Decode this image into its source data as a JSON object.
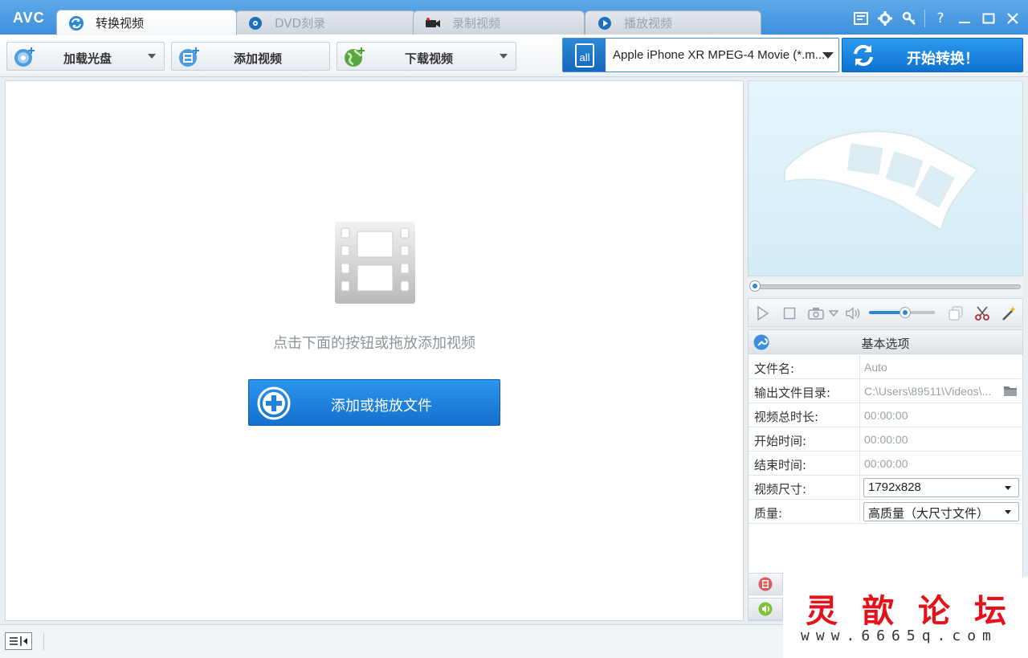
{
  "app": {
    "logo": "AVC"
  },
  "tabs": [
    {
      "label": "转换视频",
      "active": true,
      "icon": "refresh-icon"
    },
    {
      "label": "DVD刻录",
      "active": false,
      "icon": "disc-icon"
    },
    {
      "label": "录制视频",
      "active": false,
      "icon": "camera-icon"
    },
    {
      "label": "播放视频",
      "active": false,
      "icon": "play-icon"
    }
  ],
  "window_controls": [
    "list-icon",
    "gear-icon",
    "key-icon",
    "help-icon",
    "minimize-icon",
    "maximize-icon",
    "close-icon"
  ],
  "toolbar": {
    "load_disc": "加载光盘",
    "add_video": "添加视频",
    "download_video": "下载视频",
    "profile_selected": "Apple iPhone XR MPEG-4 Movie (*.m...",
    "convert": "开始转换！"
  },
  "main": {
    "hint": "点击下面的按钮或拖放添加视频",
    "add_button": "添加或拖放文件"
  },
  "player": {
    "seek_position": 0,
    "volume": 0.55
  },
  "options": {
    "title": "基本选项",
    "rows": [
      {
        "label": "文件名:",
        "value": "Auto"
      },
      {
        "label": "输出文件目录:",
        "value": "C:\\Users\\89511\\Videos\\..."
      },
      {
        "label": "视频总时长:",
        "value": "00:00:00"
      },
      {
        "label": "开始时间:",
        "value": "00:00:00"
      },
      {
        "label": "结束时间:",
        "value": "00:00:00"
      },
      {
        "label": "视频尺寸:",
        "value": "1792x828"
      },
      {
        "label": "质量:",
        "value": "高质量（大尺寸文件）"
      }
    ]
  },
  "watermark": {
    "title": "灵歆论坛",
    "url": "www.6665q.com"
  },
  "colors": {
    "accent": "#1f82dc",
    "title_bar": "#4b9be3",
    "watermark_red": "#e4121b"
  }
}
